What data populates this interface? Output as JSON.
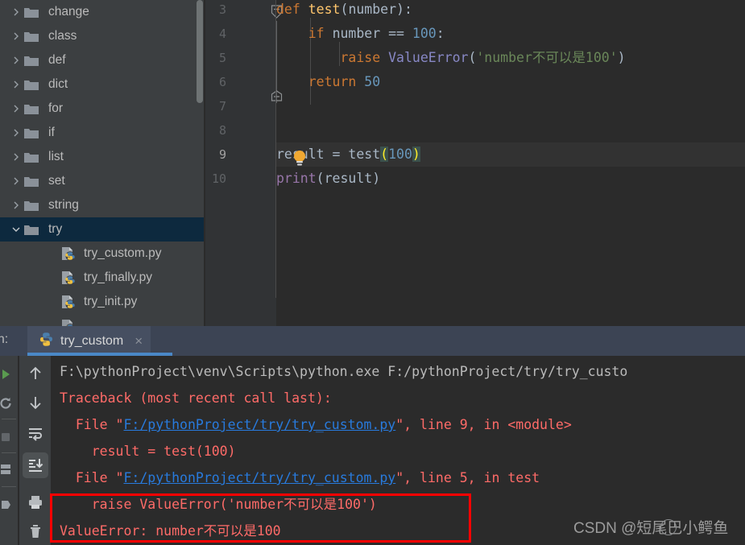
{
  "project_tree": {
    "items": [
      {
        "label": "change",
        "type": "folder",
        "expanded": false,
        "selected": false
      },
      {
        "label": "class",
        "type": "folder",
        "expanded": false,
        "selected": false
      },
      {
        "label": "def",
        "type": "folder",
        "expanded": false,
        "selected": false
      },
      {
        "label": "dict",
        "type": "folder",
        "expanded": false,
        "selected": false
      },
      {
        "label": "for",
        "type": "folder",
        "expanded": false,
        "selected": false
      },
      {
        "label": "if",
        "type": "folder",
        "expanded": false,
        "selected": false
      },
      {
        "label": "list",
        "type": "folder",
        "expanded": false,
        "selected": false
      },
      {
        "label": "set",
        "type": "folder",
        "expanded": false,
        "selected": false
      },
      {
        "label": "string",
        "type": "folder",
        "expanded": false,
        "selected": false
      },
      {
        "label": "try",
        "type": "folder",
        "expanded": true,
        "selected": true
      },
      {
        "label": "try_custom.py",
        "type": "python-file",
        "expanded": false,
        "selected": false
      },
      {
        "label": "try_finally.py",
        "type": "python-file",
        "expanded": false,
        "selected": false
      },
      {
        "label": "try_init.py",
        "type": "python-file",
        "expanded": false,
        "selected": false
      }
    ]
  },
  "editor": {
    "line_numbers": [
      "3",
      "4",
      "5",
      "6",
      "7",
      "8",
      "9",
      "10"
    ],
    "current_line": "9",
    "lines": [
      {
        "num": "3",
        "text": "def test(number):"
      },
      {
        "num": "4",
        "text": "    if number == 100:"
      },
      {
        "num": "5",
        "text": "        raise ValueError('number不可以是100')"
      },
      {
        "num": "6",
        "text": "    return 50"
      },
      {
        "num": "7",
        "text": ""
      },
      {
        "num": "8",
        "text": ""
      },
      {
        "num": "9",
        "text": "result = test(100)"
      },
      {
        "num": "10",
        "text": "print(result)"
      }
    ],
    "tokens": {
      "kw_def": "def",
      "fn_test": "test",
      "p_open": "(",
      "arg_number": "number",
      "p_close": ")",
      "colon": ":",
      "kw_if": "if",
      "eq": "==",
      "num_100": "100",
      "kw_raise": "raise",
      "cls_ValueError": "ValueError",
      "str_msg": "'number不可以是100'",
      "kw_return": "return",
      "num_50": "50",
      "var_result": "result",
      "assign": "=",
      "call_test": "test",
      "paren_l": "(",
      "call_num": "100",
      "paren_r": ")",
      "fn_print": "print",
      "print_arg": "(result)"
    },
    "colors": {
      "background": "#2b2b2b",
      "gutter": "#313335",
      "keyword": "#cc7832",
      "function": "#ffc66d",
      "number": "#6897bb",
      "string": "#6a8759",
      "class": "#8888c6",
      "plain": "#a9b7c6",
      "line_number": "#606366",
      "current_line_highlight": "#323232",
      "matched_paren": "#ffef28"
    },
    "intention_bulb": "lightbulb-icon"
  },
  "run_panel": {
    "title": "un:",
    "tab": {
      "label": "try_custom",
      "icon": "python-icon",
      "close": "×"
    },
    "toolbar_left": [
      "run-icon",
      "rerun-icon",
      "stop-icon",
      "layout-icon",
      "pin-icon",
      "expand-icon"
    ],
    "toolbar": [
      "scroll-up-icon",
      "scroll-down-icon",
      "soft-wrap-icon",
      "scroll-to-end-icon",
      "print-icon",
      "trash-icon"
    ],
    "active_tool": "scroll-to-end-icon",
    "console_lines": [
      {
        "type": "out",
        "segments": [
          {
            "t": "F:\\pythonProject\\venv\\Scripts\\python.exe F:/pythonProject/try/try_custo",
            "style": "out"
          }
        ]
      },
      {
        "type": "err",
        "segments": [
          {
            "t": "Traceback (most recent call last):",
            "style": "err"
          }
        ]
      },
      {
        "type": "err",
        "segments": [
          {
            "t": "  File \"",
            "style": "err"
          },
          {
            "t": "F:/pythonProject/try/try_custom.py",
            "style": "link"
          },
          {
            "t": "\", line 9, in <module>",
            "style": "err"
          }
        ]
      },
      {
        "type": "err",
        "segments": [
          {
            "t": "    result = test(100)",
            "style": "err"
          }
        ]
      },
      {
        "type": "err",
        "segments": [
          {
            "t": "  File \"",
            "style": "err"
          },
          {
            "t": "F:/pythonProject/try/try_custom.py",
            "style": "link"
          },
          {
            "t": "\", line 5, in test",
            "style": "err"
          }
        ]
      },
      {
        "type": "err",
        "segments": [
          {
            "t": "    raise ValueError('number不可以是100')",
            "style": "err"
          }
        ]
      },
      {
        "type": "err",
        "segments": [
          {
            "t": "ValueError: number不可以是100",
            "style": "err"
          }
        ]
      }
    ],
    "colors": {
      "output": "#bbbbbb",
      "error": "#ff6b68",
      "link": "#287bde",
      "tabbar": "#3c4454",
      "tab_active_underline": "#4a88c7"
    }
  },
  "annotation": {
    "highlight_box_color": "#ff0000"
  },
  "watermark": {
    "text": "CSDN @短尾巴小鳄鱼"
  }
}
